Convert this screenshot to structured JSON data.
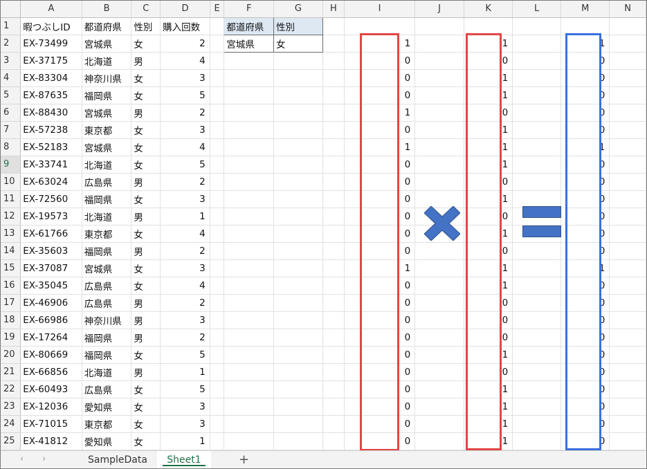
{
  "columns": [
    "A",
    "B",
    "C",
    "D",
    "E",
    "F",
    "G",
    "H",
    "I",
    "J",
    "K",
    "L",
    "M",
    "N"
  ],
  "header_row": {
    "A": "暇つぶしID",
    "B": "都道府県",
    "C": "性別",
    "D": "購入回数",
    "F": "都道府県",
    "G": "性別"
  },
  "criteria": {
    "F": "宮城県",
    "G": "女"
  },
  "rows": [
    {
      "n": 2,
      "A": "EX-73499",
      "B": "宮城県",
      "C": "女",
      "D": "2",
      "I": "1",
      "K": "1",
      "M": "1"
    },
    {
      "n": 3,
      "A": "EX-37175",
      "B": "北海道",
      "C": "男",
      "D": "4",
      "I": "0",
      "K": "0",
      "M": "0"
    },
    {
      "n": 4,
      "A": "EX-83304",
      "B": "神奈川県",
      "C": "女",
      "D": "3",
      "I": "0",
      "K": "1",
      "M": "0"
    },
    {
      "n": 5,
      "A": "EX-87635",
      "B": "福岡県",
      "C": "女",
      "D": "5",
      "I": "0",
      "K": "1",
      "M": "0"
    },
    {
      "n": 6,
      "A": "EX-88430",
      "B": "宮城県",
      "C": "男",
      "D": "2",
      "I": "1",
      "K": "0",
      "M": "0"
    },
    {
      "n": 7,
      "A": "EX-57238",
      "B": "東京都",
      "C": "女",
      "D": "3",
      "I": "0",
      "K": "1",
      "M": "0"
    },
    {
      "n": 8,
      "A": "EX-52183",
      "B": "宮城県",
      "C": "女",
      "D": "4",
      "I": "1",
      "K": "1",
      "M": "1"
    },
    {
      "n": 9,
      "A": "EX-33741",
      "B": "北海道",
      "C": "女",
      "D": "5",
      "I": "0",
      "K": "1",
      "M": "0"
    },
    {
      "n": 10,
      "A": "EX-63024",
      "B": "広島県",
      "C": "男",
      "D": "2",
      "I": "0",
      "K": "0",
      "M": "0"
    },
    {
      "n": 11,
      "A": "EX-72560",
      "B": "福岡県",
      "C": "女",
      "D": "3",
      "I": "0",
      "K": "1",
      "M": "0"
    },
    {
      "n": 12,
      "A": "EX-19573",
      "B": "北海道",
      "C": "男",
      "D": "1",
      "I": "0",
      "K": "0",
      "M": "0"
    },
    {
      "n": 13,
      "A": "EX-61766",
      "B": "東京都",
      "C": "女",
      "D": "4",
      "I": "0",
      "K": "1",
      "M": "0"
    },
    {
      "n": 14,
      "A": "EX-35603",
      "B": "福岡県",
      "C": "男",
      "D": "2",
      "I": "0",
      "K": "0",
      "M": "0"
    },
    {
      "n": 15,
      "A": "EX-37087",
      "B": "宮城県",
      "C": "女",
      "D": "3",
      "I": "1",
      "K": "1",
      "M": "1"
    },
    {
      "n": 16,
      "A": "EX-35045",
      "B": "広島県",
      "C": "女",
      "D": "4",
      "I": "0",
      "K": "1",
      "M": "0"
    },
    {
      "n": 17,
      "A": "EX-46906",
      "B": "広島県",
      "C": "男",
      "D": "2",
      "I": "0",
      "K": "0",
      "M": "0"
    },
    {
      "n": 18,
      "A": "EX-66986",
      "B": "神奈川県",
      "C": "男",
      "D": "3",
      "I": "0",
      "K": "0",
      "M": "0"
    },
    {
      "n": 19,
      "A": "EX-17264",
      "B": "福岡県",
      "C": "男",
      "D": "2",
      "I": "0",
      "K": "0",
      "M": "0"
    },
    {
      "n": 20,
      "A": "EX-80669",
      "B": "福岡県",
      "C": "女",
      "D": "5",
      "I": "0",
      "K": "1",
      "M": "0"
    },
    {
      "n": 21,
      "A": "EX-66856",
      "B": "北海道",
      "C": "男",
      "D": "1",
      "I": "0",
      "K": "0",
      "M": "0"
    },
    {
      "n": 22,
      "A": "EX-60493",
      "B": "広島県",
      "C": "女",
      "D": "5",
      "I": "0",
      "K": "1",
      "M": "0"
    },
    {
      "n": 23,
      "A": "EX-12036",
      "B": "愛知県",
      "C": "女",
      "D": "3",
      "I": "0",
      "K": "1",
      "M": "0"
    },
    {
      "n": 24,
      "A": "EX-71015",
      "B": "東京都",
      "C": "女",
      "D": "3",
      "I": "0",
      "K": "1",
      "M": "0"
    },
    {
      "n": 25,
      "A": "EX-41812",
      "B": "愛知県",
      "C": "女",
      "D": "1",
      "I": "0",
      "K": "1",
      "M": "0"
    }
  ],
  "selected_row": 9,
  "shapes": {
    "multiply_icon": "multiply-sign",
    "equals_icon": "equals-sign",
    "shape_fill": "#4472c4",
    "red_outline": "#e24646",
    "blue_outline": "#3a6fdf"
  },
  "sheet_tabs": [
    {
      "label": "SampleData",
      "active": false
    },
    {
      "label": "Sheet1",
      "active": true
    }
  ],
  "tab_nav": {
    "prev": "‹",
    "next": "›",
    "add": "+"
  }
}
